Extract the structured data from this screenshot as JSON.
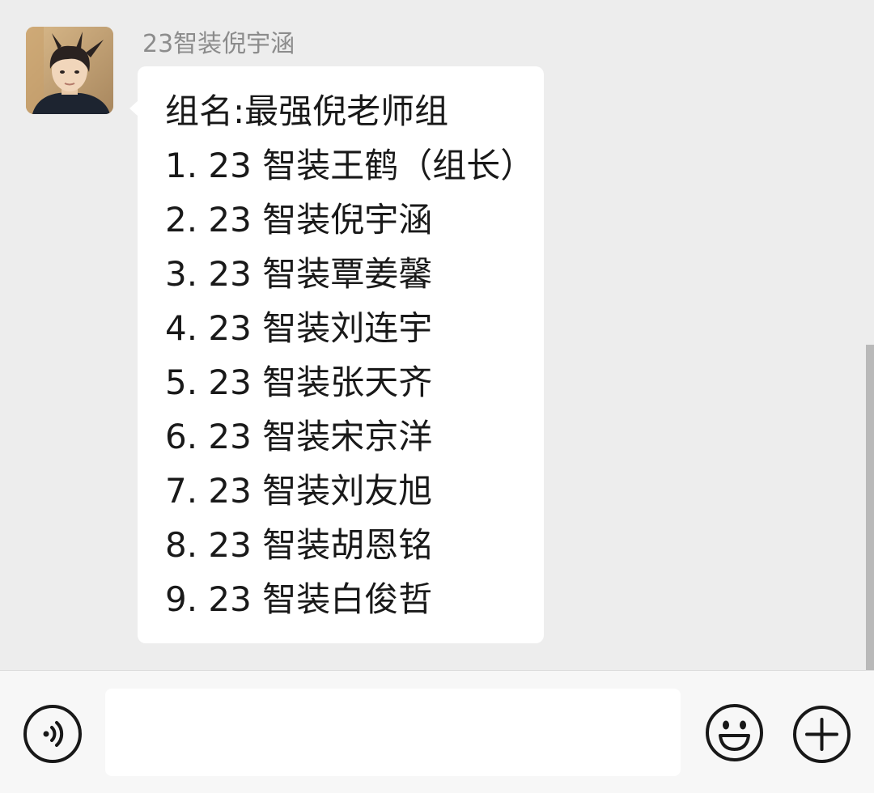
{
  "message": {
    "sender_name": "23智装倪宇涵",
    "lines": [
      "组名:最强倪老师组",
      "1. 23 智装王鹤（组长）",
      "2. 23 智装倪宇涵",
      "3. 23 智装覃姜馨",
      "4. 23 智装刘连宇",
      "5. 23 智装张天齐",
      "6. 23 智装宋京洋",
      "7. 23 智装刘友旭",
      "8. 23 智装胡恩铭",
      "9. 23 智装白俊哲"
    ]
  },
  "input_bar": {
    "value": "",
    "placeholder": "",
    "voice_icon": "voice-icon",
    "emoji_icon": "emoji-icon",
    "add_icon": "plus-icon"
  },
  "colors": {
    "chat_background": "#ededed",
    "bubble_background": "#ffffff",
    "sender_name": "#8c8c8c",
    "message_text": "#191919",
    "input_bar_background": "#f7f7f7",
    "icon_stroke": "#181818"
  }
}
